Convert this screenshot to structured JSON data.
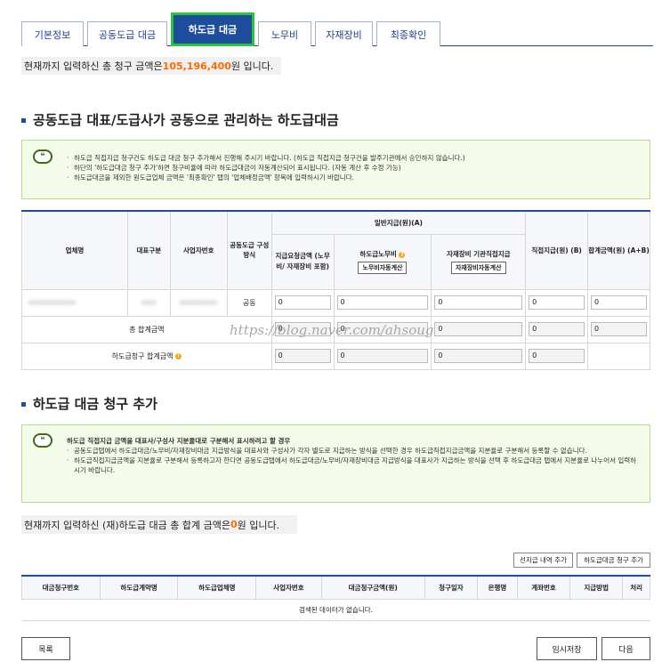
{
  "tabs": [
    {
      "label": "기본정보"
    },
    {
      "label": "공동도급 대금"
    },
    {
      "label": "하도급 대금"
    },
    {
      "label": "노무비"
    },
    {
      "label": "자재장비"
    },
    {
      "label": "최종확인"
    }
  ],
  "summary1": {
    "prefix": "현재까지 입력하신 총 청구 금액은 ",
    "amount": "105,196,400",
    "suffix": "원 입니다."
  },
  "section1": {
    "title": "공동도급 대표/도급사가 공동으로 관리하는 하도급대금",
    "notice_items": [
      "하도급 직접지급 청구건도 하도급 대금 청구 추가해서 진행해 주시기 바랍니다. (하도급 직접지급 청구건을 발주기관에서 승인하지 않습니다.)",
      "하단의 '하도급대금 청구 추가'하면 청구비율에 따라 하도급대금이 자동계산되어 표시됩니다. (자동 계산 후 수정 가능)",
      "하도급대금을 제외한 원도급업체 금액은 '최종확인' 탭의 '업체배정금액' 항목에 입력하시기 바랍니다."
    ]
  },
  "table1": {
    "headers": {
      "company": "업체명",
      "rep_type": "대표구분",
      "biz_no": "사업자번호",
      "joint_type": "공동도급 구성방식",
      "general": "일반지급(원)(A)",
      "request_amount": "지급요청금액 (노무비/ 자재장비 포함)",
      "labor": "하도급노무비",
      "labor_btn": "노무비자동계산",
      "material": "자재장비 기관직접지급",
      "material_btn": "자재장비자동계산",
      "direct": "직접지급(원) (B)",
      "total": "합계금액(원) (A+B)"
    },
    "row": {
      "joint": "공동",
      "v1": "0",
      "v2": "0",
      "v3": "0",
      "v4": "0",
      "v5": "0"
    },
    "sum_row": {
      "label": "총 합계금액",
      "v1": "0",
      "v2": "0",
      "v3": "0",
      "v4": "0",
      "v5": "0"
    },
    "sub_row": {
      "label": "하도급청구 합계금액",
      "v1": "0",
      "v2": "0",
      "v3": "0",
      "v4": "0"
    }
  },
  "watermark": "https://blog.naver.com/ahsoug",
  "section2": {
    "title": "하도급 대금 청구 추가",
    "notice_head": "하도급 직접지급 금액을 대표사/구성사 지분율대로 구분해서 표시하려고 할 경우",
    "notice_items": [
      "공동도급탭에서 하도급대금/노무비/자재장비대금 지급방식을 대표사와 구성사가 각자 별도로 지급하는 방식을 선택한 경우 하도급직접지급금액을 지분율로 구분해서 등록할 수 없습니다.",
      "하도급직접지급금액을 지분율로 구분해서 등록하고자 한다면 공동도급탭에서 하도급대금/노무비/자재장비대금 지급방식을 대표사가 지급하는 방식을 선택 후 하도급대금 탭에서 지분율로 나누어서 입력하시기 바랍니다."
    ]
  },
  "summary2": {
    "prefix": "현재까지 입력하신 (재)하도급 대금 총 합계 금액은 ",
    "amount": "0",
    "suffix": "원 입니다."
  },
  "buttons": {
    "prepaid": "선지급 내역 추가",
    "add_claim": "하도급대금 청구 추가",
    "list": "목록",
    "save": "임시저장",
    "next": "다음"
  },
  "table2": {
    "headers": [
      "대금청구번호",
      "하도급계약명",
      "하도급업체명",
      "사업자번호",
      "대금청구금액(원)",
      "청구일자",
      "은행명",
      "계좌번호",
      "지급방법",
      "처리"
    ],
    "empty": "검색된 데이터가 없습니다."
  }
}
